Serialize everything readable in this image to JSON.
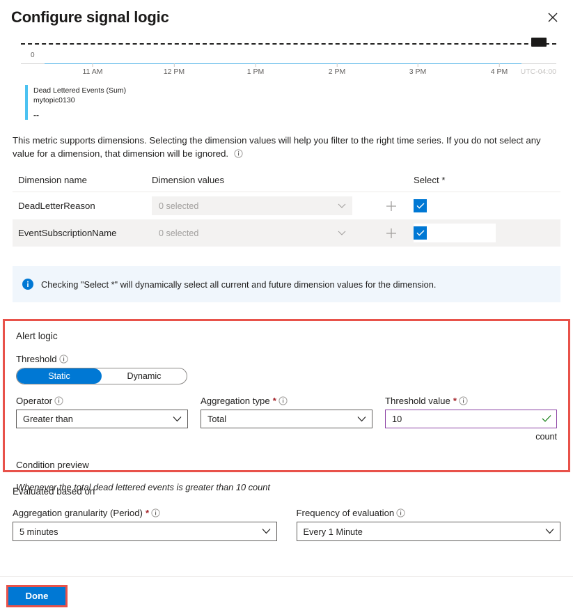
{
  "header": {
    "title": "Configure signal logic",
    "close_label": "Close"
  },
  "chart": {
    "y_zero_label": "0",
    "timezone_label": "UTC-04:00",
    "x_ticks": [
      "11 AM",
      "12 PM",
      "1 PM",
      "2 PM",
      "3 PM",
      "4 PM"
    ],
    "legend": {
      "metric": "Dead Lettered Events (Sum)",
      "resource": "mytopic0130",
      "value": "--"
    }
  },
  "chart_data": {
    "type": "line",
    "title": "Dead Lettered Events (Sum)",
    "subtitle": "mytopic0130",
    "xlabel": "",
    "ylabel": "",
    "x": [
      "11 AM",
      "12 PM",
      "1 PM",
      "2 PM",
      "3 PM",
      "4 PM"
    ],
    "series": [
      {
        "name": "Dead Lettered Events (Sum) - mytopic0130",
        "values": [
          0,
          0,
          0,
          0,
          0,
          0
        ],
        "color": "#4cc2f1"
      }
    ],
    "threshold_line": {
      "value": 10,
      "style": "dashed",
      "color": "#201f1e"
    },
    "ylim": [
      0,
      12
    ],
    "yticks": [
      0
    ],
    "grid": false,
    "legend_position": "bottom-left",
    "timezone": "UTC-04:00",
    "current_value": "--"
  },
  "dimensions": {
    "description": "This metric supports dimensions. Selecting the dimension values will help you filter to the right time series. If you do not select any value for a dimension, that dimension will be ignored.",
    "columns": {
      "name": "Dimension name",
      "values": "Dimension values",
      "select": "Select *"
    },
    "rows": [
      {
        "name": "DeadLetterReason",
        "value_placeholder": "0 selected",
        "checked": true
      },
      {
        "name": "EventSubscriptionName",
        "value_placeholder": "0 selected",
        "checked": true
      }
    ],
    "add_button_label": "+"
  },
  "info_banner": {
    "text": "Checking \"Select *\" will dynamically select all current and future dimension values for the dimension."
  },
  "alert_logic": {
    "group_title": "Alert logic",
    "threshold_label": "Threshold",
    "threshold_options": [
      "Static",
      "Dynamic"
    ],
    "threshold_selected": "Static",
    "operator_label": "Operator",
    "operator_value": "Greater than",
    "aggregation_label": "Aggregation type",
    "aggregation_value": "Total",
    "threshold_value_label": "Threshold value",
    "threshold_value": "10",
    "threshold_unit": "count",
    "condition_preview_label": "Condition preview",
    "condition_preview_text": "Whenever the total dead lettered events is greater than 10 count"
  },
  "evaluated": {
    "section_title": "Evaluated based on",
    "granularity_label": "Aggregation granularity (Period)",
    "granularity_value": "5 minutes",
    "frequency_label": "Frequency of evaluation",
    "frequency_value": "Every 1 Minute"
  },
  "footer": {
    "done_label": "Done"
  },
  "colors": {
    "accent": "#0078d4",
    "annotation": "#e8524a",
    "series": "#4cc2f1",
    "required": "#a4262c",
    "validated_border": "#8a3fa3",
    "info_bg": "#f0f6fc"
  }
}
